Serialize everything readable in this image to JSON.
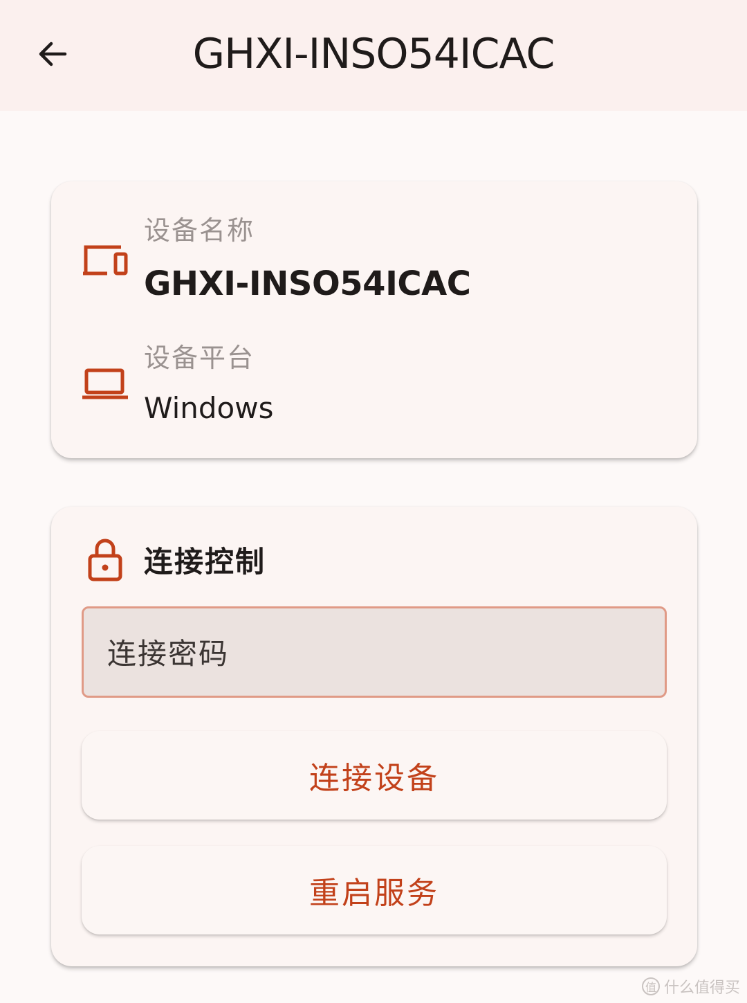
{
  "appbar": {
    "title": "GHXI-INSO54ICAC",
    "back_icon": "arrow-left-icon"
  },
  "device_info": {
    "name_label": "设备名称",
    "name_value": "GHXI-INSO54ICAC",
    "name_icon": "devices-icon",
    "platform_label": "设备平台",
    "platform_value": "Windows",
    "platform_icon": "laptop-icon"
  },
  "connection_control": {
    "title": "连接控制",
    "title_icon": "lock-icon",
    "password_placeholder": "连接密码",
    "password_value": "",
    "connect_button": "连接设备",
    "restart_button": "重启服务"
  },
  "watermark": {
    "text": "什么值得买"
  },
  "colors": {
    "accent": "#c2411a",
    "appbar_bg": "#fbf0ee",
    "page_bg": "#fdf9f8",
    "card_bg": "#fcf5f3",
    "field_bg": "#ebe2df",
    "field_border": "#e09a86",
    "label_gray": "#9a9290"
  }
}
